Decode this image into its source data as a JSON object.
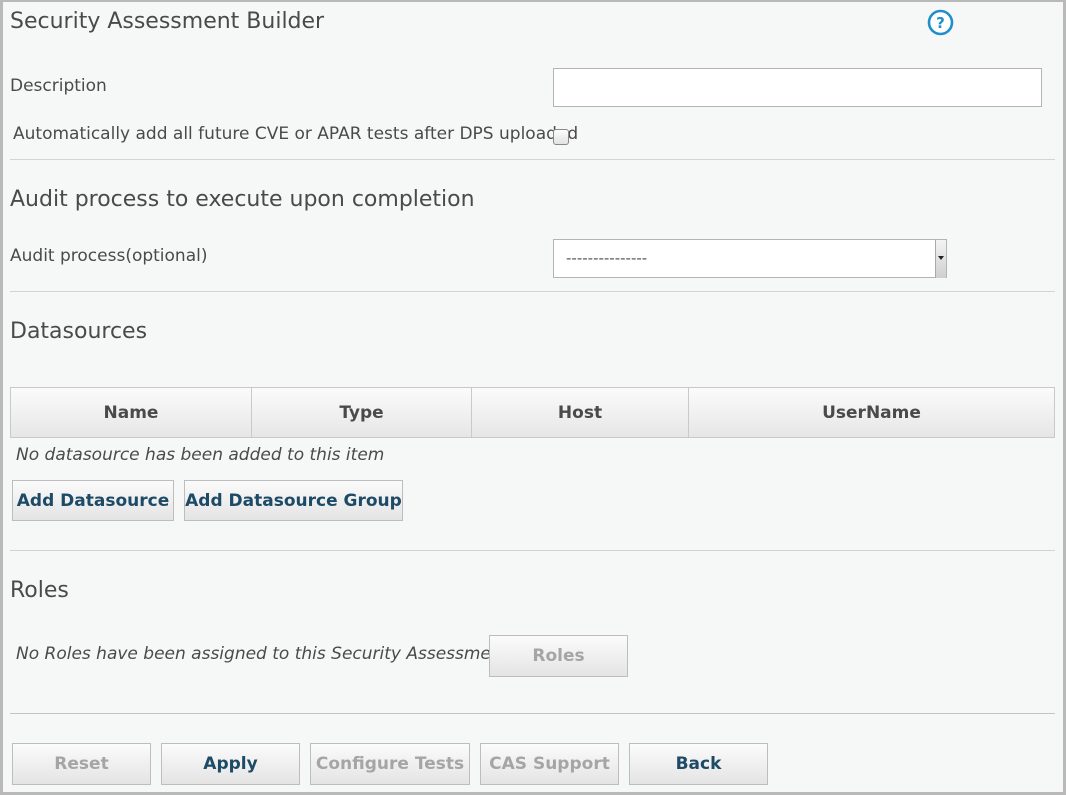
{
  "header": {
    "title": "Security Assessment Builder",
    "help_icon": "help-icon"
  },
  "form": {
    "description_label": "Description",
    "description_value": "",
    "auto_add_label": "Automatically add all future CVE or APAR tests after DPS uploaded",
    "auto_add_checked": false
  },
  "audit": {
    "heading": "Audit process to execute upon completion",
    "label": "Audit process(optional)",
    "selected": "---------------"
  },
  "datasources": {
    "heading": "Datasources",
    "columns": [
      "Name",
      "Type",
      "Host",
      "UserName"
    ],
    "empty_text": "No datasource has been added to this item",
    "add_button": "Add Datasource",
    "add_group_button": "Add Datasource Group"
  },
  "roles": {
    "heading": "Roles",
    "empty_text": "No Roles have been assigned to this Security Assessment",
    "roles_button": "Roles"
  },
  "footer": {
    "reset": "Reset",
    "apply": "Apply",
    "configure_tests": "Configure Tests",
    "cas_support": "CAS Support",
    "back": "Back"
  },
  "colors": {
    "link_text": "#1d4a66",
    "disabled_text": "#a5a5a5",
    "help_blue": "#1f8ec9"
  }
}
